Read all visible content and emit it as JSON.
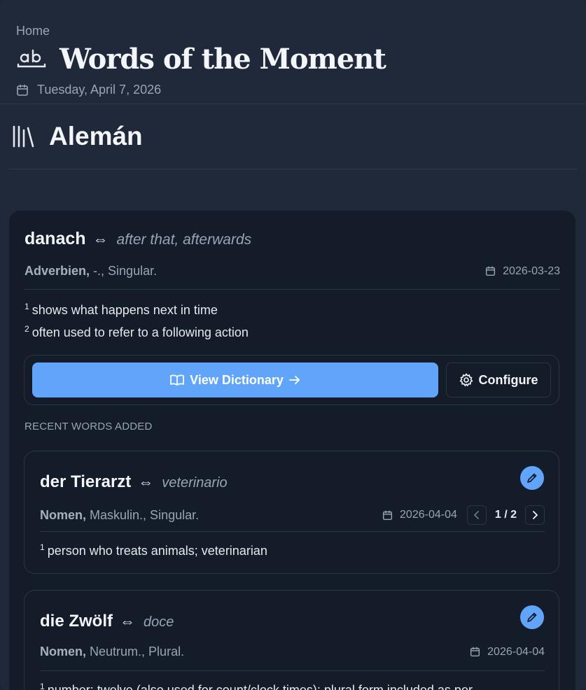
{
  "header": {
    "breadcrumb": "Home",
    "title": "Words of the Moment",
    "date": "Tuesday, April 7, 2026",
    "icons": {
      "title": "ab-text-icon",
      "date": "calendar-icon"
    }
  },
  "section": {
    "title": "Alemán",
    "icon": "library-icon"
  },
  "main_word": {
    "word": "danach",
    "arrow": "⇔",
    "translation": "after that, afterwards",
    "pos": "Adverbien,",
    "attributes": "-., Singular.",
    "date": "2026-03-23",
    "definitions": [
      {
        "num": "1",
        "text": "shows what happens next in time"
      },
      {
        "num": "2",
        "text": "often used to refer to a following action"
      }
    ]
  },
  "actions": {
    "view_dictionary": "View Dictionary",
    "configure": "Configure"
  },
  "recent": {
    "label": "RECENT WORDS ADDED",
    "items": [
      {
        "word": "der Tierarzt",
        "arrow": "⇔",
        "translation": "veterinario",
        "pos": "Nomen,",
        "attributes": "Maskulin., Singular.",
        "date": "2026-04-04",
        "pager": "1 / 2",
        "definitions": [
          {
            "num": "1",
            "text": "person who treats animals; veterinarian"
          }
        ]
      },
      {
        "word": "die Zwölf",
        "arrow": "⇔",
        "translation": "doce",
        "pos": "Nomen,",
        "attributes": "Neutrum., Plural.",
        "date": "2026-04-04",
        "definitions": [
          {
            "num": "1",
            "text": "number: twelve (also used for count/clock times); plural form included as per"
          }
        ]
      }
    ]
  },
  "colors": {
    "accent": "#60a5fa",
    "background": "#1f2939",
    "card": "#141b29"
  }
}
